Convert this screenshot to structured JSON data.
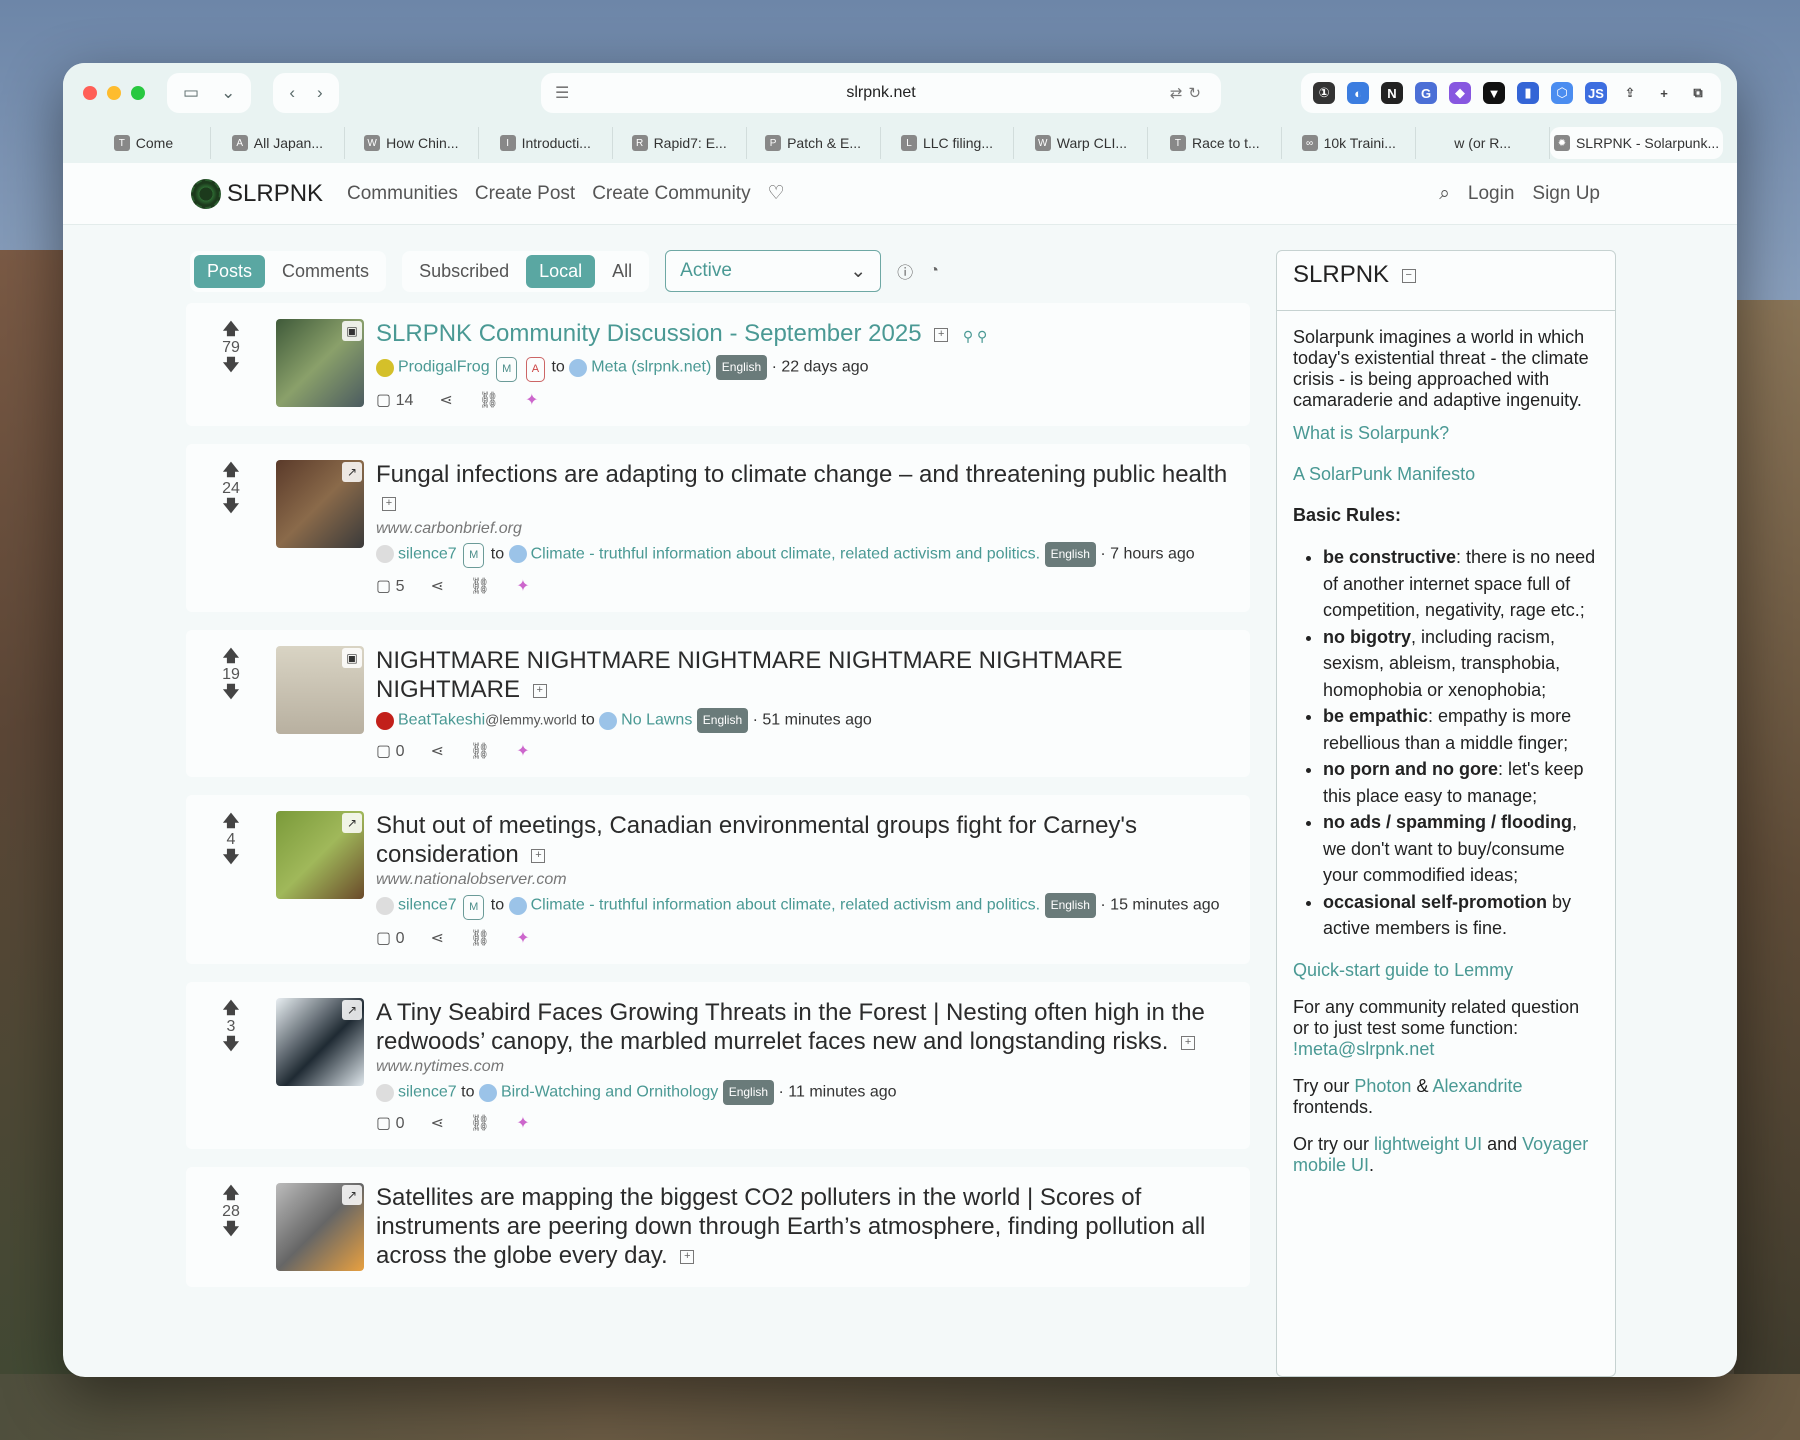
{
  "browser": {
    "url": "slrpnk.net",
    "tabs": [
      {
        "label": "Come",
        "icon": "T"
      },
      {
        "label": "All Japan...",
        "icon": "A"
      },
      {
        "label": "How Chin...",
        "icon": "W"
      },
      {
        "label": "Introducti...",
        "icon": "I"
      },
      {
        "label": "Rapid7: E...",
        "icon": "R"
      },
      {
        "label": "Patch & E...",
        "icon": "P"
      },
      {
        "label": "LLC filing...",
        "icon": "L"
      },
      {
        "label": "Warp CLI...",
        "icon": "W"
      },
      {
        "label": "Race to t...",
        "icon": "T"
      },
      {
        "label": "10k Traini...",
        "icon": "∞"
      },
      {
        "label": "w (or R...",
        "icon": ""
      },
      {
        "label": "SLRPNK - Solarpunk...",
        "icon": "✹"
      }
    ]
  },
  "nav": {
    "brand": "SLRPNK",
    "links": [
      "Communities",
      "Create Post",
      "Create Community"
    ],
    "login": "Login",
    "signup": "Sign Up"
  },
  "filters": {
    "type": [
      "Posts",
      "Comments"
    ],
    "listing": [
      "Subscribed",
      "Local",
      "All"
    ],
    "sort": "Active"
  },
  "posts": [
    {
      "score": "79",
      "title": "SLRPNK Community Discussion - September 2025",
      "domain": "",
      "user": "ProdigalFrog",
      "badges": [
        "M",
        "A"
      ],
      "to": "to",
      "community": "Meta (slrpnk.net)",
      "lang": "English",
      "time": "· 22 days ago",
      "comments": "14",
      "pinned": true
    },
    {
      "score": "24",
      "title": "Fungal infections are adapting to climate change – and threatening public health",
      "domain": "www.carbonbrief.org",
      "user": "silence7",
      "badges": [
        "M"
      ],
      "to": "to",
      "community": "Climate - truthful information about climate, related activism and politics.",
      "lang": "English",
      "time": "· 7 hours ago",
      "comments": "5",
      "pinned": false
    },
    {
      "score": "19",
      "title": "NIGHTMARE NIGHTMARE NIGHTMARE NIGHTMARE NIGHTMARE NIGHTMARE",
      "domain": "",
      "user": "BeatTakeshi",
      "user_suffix": "@lemmy.world",
      "badges": [],
      "to": "to",
      "community": "No Lawns",
      "lang": "English",
      "time": "· 51 minutes ago",
      "comments": "0",
      "pinned": false
    },
    {
      "score": "4",
      "title": "Shut out of meetings, Canadian environmental groups fight for Carney's consideration",
      "domain": "www.nationalobserver.com",
      "user": "silence7",
      "badges": [
        "M"
      ],
      "to": "to",
      "community": "Climate - truthful information about climate, related activism and politics.",
      "lang": "English",
      "time": "· 15 minutes ago",
      "comments": "0",
      "pinned": false
    },
    {
      "score": "3",
      "title": "A Tiny Seabird Faces Growing Threats in the Forest | Nesting often high in the redwoods’ canopy, the marbled murrelet faces new and longstanding risks.",
      "domain": "www.nytimes.com",
      "user": "silence7",
      "badges": [],
      "to": "to",
      "community": "Bird-Watching and Ornithology",
      "lang": "English",
      "time": "· 11 minutes ago",
      "comments": "0",
      "pinned": false
    },
    {
      "score": "28",
      "title": "Satellites are mapping the biggest CO2 polluters in the world | Scores of instruments are peering down through Earth’s atmosphere, finding pollution all across the globe every day.",
      "domain": "",
      "user": "",
      "badges": [],
      "to": "",
      "community": "",
      "lang": "",
      "time": "",
      "comments": "",
      "pinned": false
    }
  ],
  "sidebar": {
    "title": "SLRPNK",
    "intro": "Solarpunk imagines a world in which today's existential threat - the climate crisis - is being approached with camaraderie and adaptive ingenuity.",
    "link1": "What is Solarpunk?",
    "link2": "A SolarPunk Manifesto",
    "rules_heading": "Basic Rules:",
    "rules": [
      {
        "b": "be constructive",
        "t": ": there is no need of another internet space full of competition, negativity, rage etc.;"
      },
      {
        "b": "no bigotry",
        "t": ", including racism, sexism, ableism, transphobia, homophobia or xenophobia;"
      },
      {
        "b": "be empathic",
        "t": ": empathy is more rebellious than a middle finger;"
      },
      {
        "b": "no porn and no gore",
        "t": ": let's keep this place easy to manage;"
      },
      {
        "b": "no ads / spamming / flooding",
        "t": ", we don't want to buy/consume your commodified ideas;"
      },
      {
        "b": "occasional self-promotion",
        "t": " by active members is fine."
      }
    ],
    "link3": "Quick-start guide to Lemmy",
    "community_q": "For any community related question or to just test some function:",
    "meta_link": "!meta@slrpnk.net",
    "try_prefix": "Try our",
    "photon": "Photon",
    "amp": "&",
    "alexandrite": "Alexandrite",
    "frontends": "frontends.",
    "or_prefix": "Or try our",
    "lightweight": "lightweight UI",
    "and": "and",
    "voyager": "Voyager mobile UI",
    "period": "."
  },
  "colors": {
    "accent": "#5aa7a2",
    "link": "#4a9994",
    "page_bg": "#f4f9f9"
  }
}
